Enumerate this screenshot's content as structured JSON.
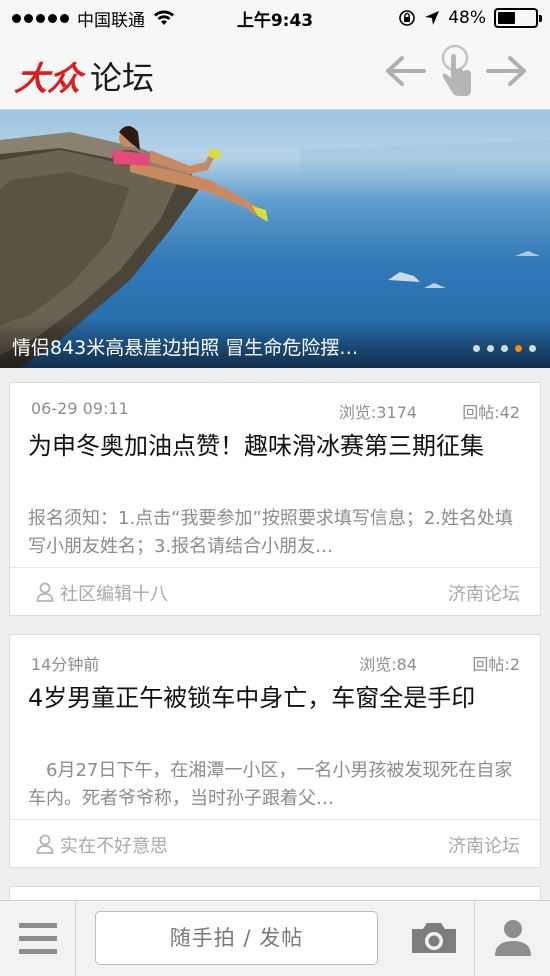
{
  "status_bar": {
    "carrier": "中国联通",
    "time": "上午9:43",
    "battery": "48%",
    "battery_level": 0.48
  },
  "header": {
    "logo_mark": "大众",
    "logo_text": "论坛"
  },
  "banner": {
    "caption": "情侣843米高悬崖边拍照 冒生命危险摆…",
    "dot_count": 5,
    "active_dot": 3
  },
  "posts": [
    {
      "time": "06-29 09:11",
      "views": "浏览:3174",
      "replies": "回帖:42",
      "title": "为申冬奥加油点赞！趣味滑冰赛第三期征集",
      "summary": "报名须知：1.点击“我要参加”按照要求填写信息；2.姓名处填写小朋友姓名；3.报名请结合小朋友…",
      "author": "社区编辑十八",
      "forum": "济南论坛"
    },
    {
      "time": "14分钟前",
      "views": "浏览:84",
      "replies": "回帖:2",
      "title": "4岁男童正午被锁车中身亡，车窗全是手印",
      "summary": "　6月27日下午，在湘潭一小区，一名小男孩被发现死在自家车内。死者爷爷称，当时孙子跟着父…",
      "author": "实在不好意思",
      "forum": "济南论坛"
    }
  ],
  "bottom_bar": {
    "post_placeholder": "随手拍 / 发帖"
  },
  "icons": [
    "signal-dots",
    "wifi-icon",
    "lock-rotation-icon",
    "location-arrow-icon",
    "battery-icon",
    "back-arrow-icon",
    "touch-hand-icon",
    "forward-arrow-icon",
    "person-icon",
    "menu-icon",
    "camera-icon",
    "profile-icon"
  ],
  "colors": {
    "brand_red": "#d81e1e",
    "active_dot": "#ff8a00",
    "muted_text": "#8c8c8c"
  }
}
